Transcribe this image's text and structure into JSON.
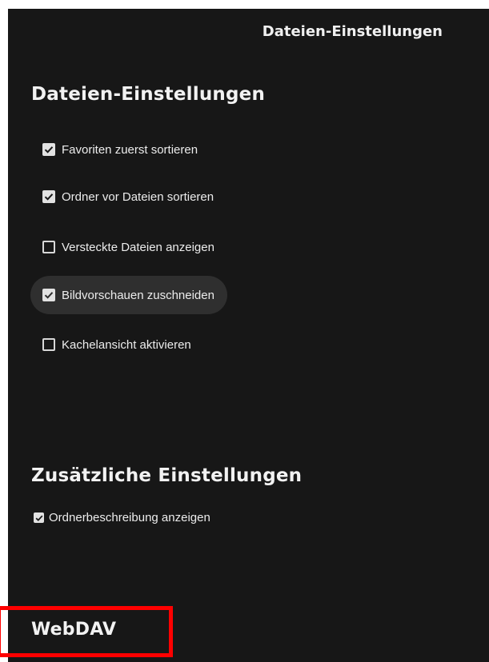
{
  "header": {
    "title": "Dateien-Einstellungen"
  },
  "main_section": {
    "title": "Dateien-Einstellungen",
    "options": [
      {
        "label": "Favoriten zuerst sortieren",
        "checked": true
      },
      {
        "label": "Ordner vor Dateien sortieren",
        "checked": true
      },
      {
        "label": "Versteckte Dateien anzeigen",
        "checked": false
      },
      {
        "label": "Bildvorschauen zuschneiden",
        "checked": true,
        "hovered": true
      },
      {
        "label": "Kachelansicht aktivieren",
        "checked": false
      }
    ]
  },
  "extra_section": {
    "title": "Zusätzliche Einstellungen",
    "option": {
      "label": "Ordnerbeschreibung anzeigen",
      "checked": true
    }
  },
  "webdav_section": {
    "title": "WebDAV"
  },
  "colors": {
    "background": "#171717",
    "hover": "#2f2f2f",
    "highlight": "#ff0000"
  }
}
